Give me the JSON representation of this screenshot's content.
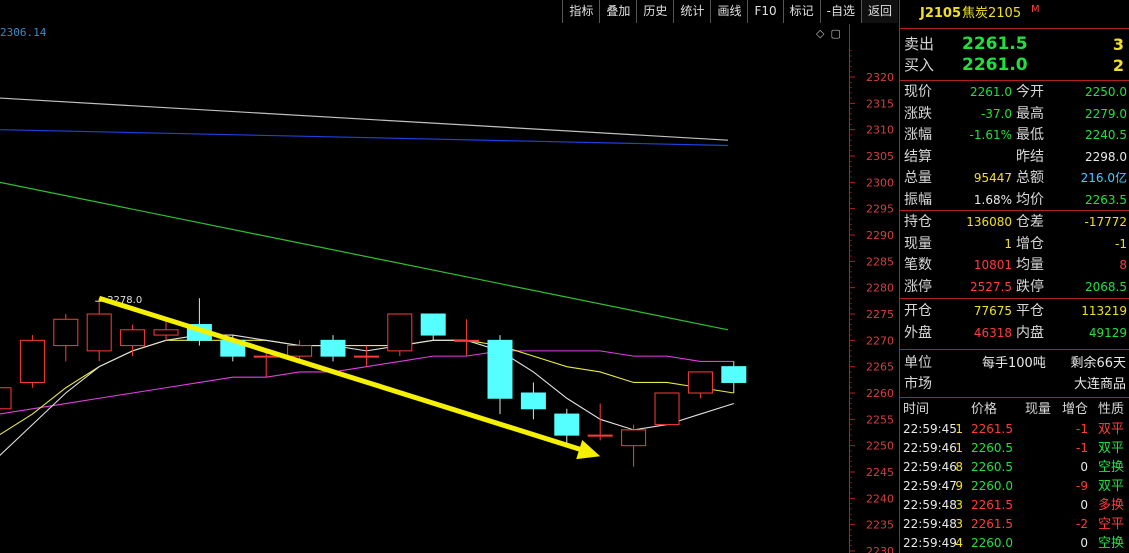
{
  "toolbar": {
    "buttons": [
      "指标",
      "叠加",
      "历史",
      "统计",
      "画线",
      "F10",
      "标记",
      "-自选",
      "返回"
    ]
  },
  "chart": {
    "top_left_value": "2306.14",
    "high_annotation": "2278.0",
    "colors": {
      "bull": "#ff3b3b",
      "bear": "#55ffff",
      "ma_white": "#e0e0e0",
      "ma_yellow": "#e8e840",
      "ma_magenta": "#e040e0",
      "ma_green": "#30c030",
      "ma_blue": "#2040e0",
      "ma_gray": "#c0c0c0",
      "arrow": "#f5f000",
      "axis_red": "#b02020"
    }
  },
  "chart_data": {
    "type": "candlestick",
    "ylim": [
      2230,
      2325
    ],
    "y_ticks": [
      2320,
      2315,
      2310,
      2305,
      2300,
      2295,
      2290,
      2285,
      2280,
      2275,
      2270,
      2265,
      2260,
      2255,
      2250,
      2245,
      2240,
      2235,
      2230
    ],
    "candles": [
      {
        "o": 2257,
        "c": 2261,
        "h": 2262,
        "l": 2256
      },
      {
        "o": 2262,
        "c": 2270,
        "h": 2271,
        "l": 2261
      },
      {
        "o": 2269,
        "c": 2274,
        "h": 2275,
        "l": 2266
      },
      {
        "o": 2268,
        "c": 2275,
        "h": 2278,
        "l": 2266
      },
      {
        "o": 2269,
        "c": 2272,
        "h": 2273,
        "l": 2267
      },
      {
        "o": 2271,
        "c": 2272,
        "h": 2274,
        "l": 2270
      },
      {
        "o": 2273,
        "c": 2270,
        "h": 2278,
        "l": 2269
      },
      {
        "o": 2270,
        "c": 2267,
        "h": 2271,
        "l": 2266
      },
      {
        "o": 2267,
        "c": 2267,
        "h": 2268,
        "l": 2263
      },
      {
        "o": 2267,
        "c": 2269,
        "h": 2270,
        "l": 2266
      },
      {
        "o": 2270,
        "c": 2267,
        "h": 2271,
        "l": 2266
      },
      {
        "o": 2267,
        "c": 2267,
        "h": 2269,
        "l": 2265
      },
      {
        "o": 2268,
        "c": 2275,
        "h": 2275,
        "l": 2267
      },
      {
        "o": 2275,
        "c": 2271,
        "h": 2275,
        "l": 2270
      },
      {
        "o": 2270,
        "c": 2270,
        "h": 2274,
        "l": 2267
      },
      {
        "o": 2270,
        "c": 2259,
        "h": 2271,
        "l": 2256
      },
      {
        "o": 2260,
        "c": 2257,
        "h": 2262,
        "l": 2255
      },
      {
        "o": 2256,
        "c": 2252,
        "h": 2257,
        "l": 2250
      },
      {
        "o": 2252,
        "c": 2252,
        "h": 2258,
        "l": 2251
      },
      {
        "o": 2250,
        "c": 2253,
        "h": 2254,
        "l": 2246
      },
      {
        "o": 2254,
        "c": 2260,
        "h": 2260,
        "l": 2254
      },
      {
        "o": 2260,
        "c": 2264,
        "h": 2264,
        "l": 2259
      },
      {
        "o": 2265,
        "c": 2262,
        "h": 2266,
        "l": 2260
      }
    ],
    "ma_white": [
      2248,
      2254,
      2260,
      2265,
      2268,
      2270,
      2271,
      2271,
      2270,
      2269,
      2269,
      2268,
      2269,
      2270,
      2270,
      2268,
      2264,
      2259,
      2255,
      2253,
      2254,
      2256,
      2258
    ],
    "ma_yellow": [
      2252,
      2256,
      2261,
      2265,
      2268,
      2270,
      2270,
      2270,
      2270,
      2269,
      2269,
      2269,
      2269,
      2270,
      2270,
      2269,
      2267,
      2265,
      2264,
      2262,
      2262,
      2261,
      2260
    ],
    "ma_magenta": [
      2256,
      2257,
      2258,
      2259,
      2260,
      2261,
      2262,
      2263,
      2263,
      2264,
      2264,
      2265,
      2266,
      2267,
      2267,
      2268,
      2268,
      2268,
      2268,
      2267,
      2267,
      2266,
      2266
    ],
    "ma_green_start": 2300,
    "ma_green_end": 2272,
    "ma_blue_start": 2310,
    "ma_blue_end": 2307,
    "ma_gray_start": 2316,
    "ma_gray_end": 2308,
    "arrow_from": {
      "index": 3,
      "value": 2278
    },
    "arrow_to": {
      "index": 18,
      "value": 2248
    }
  },
  "quote": {
    "code": "J2105",
    "name": "焦炭2105",
    "badge": "M",
    "ask": {
      "label": "卖出",
      "price": "2261.5",
      "vol": "3"
    },
    "bid": {
      "label": "买入",
      "price": "2261.0",
      "vol": "2"
    },
    "rows1": [
      {
        "l1": "现价",
        "v1": "2261.0",
        "c1": "green",
        "l2": "今开",
        "v2": "2250.0",
        "c2": "green"
      },
      {
        "l1": "涨跌",
        "v1": "-37.0",
        "c1": "green",
        "l2": "最高",
        "v2": "2279.0",
        "c2": "green"
      },
      {
        "l1": "涨幅",
        "v1": "-1.61%",
        "c1": "green",
        "l2": "最低",
        "v2": "2240.5",
        "c2": "green"
      },
      {
        "l1": "结算",
        "v1": "",
        "c1": "white",
        "l2": "昨结",
        "v2": "2298.0",
        "c2": "white"
      },
      {
        "l1": "总量",
        "v1": "95447",
        "c1": "yellow",
        "l2": "总额",
        "v2": "216.0亿",
        "c2": "cyan"
      },
      {
        "l1": "振幅",
        "v1": "1.68%",
        "c1": "white",
        "l2": "均价",
        "v2": "2263.5",
        "c2": "green"
      }
    ],
    "rows2": [
      {
        "l1": "持仓",
        "v1": "136080",
        "c1": "yellow",
        "l2": "仓差",
        "v2": "-17772",
        "c2": "yellow"
      },
      {
        "l1": "现量",
        "v1": "1",
        "c1": "yellow",
        "l2": "增仓",
        "v2": "-1",
        "c2": "yellow"
      },
      {
        "l1": "笔数",
        "v1": "10801",
        "c1": "red",
        "l2": "均量",
        "v2": "8",
        "c2": "red"
      },
      {
        "l1": "涨停",
        "v1": "2527.5",
        "c1": "red",
        "l2": "跌停",
        "v2": "2068.5",
        "c2": "green"
      }
    ],
    "rows3": [
      {
        "l1": "开仓",
        "v1": "77675",
        "c1": "yellow",
        "l2": "平仓",
        "v2": "113219",
        "c2": "yellow"
      },
      {
        "l1": "外盘",
        "v1": "46318",
        "c1": "red",
        "l2": "内盘",
        "v2": "49129",
        "c2": "green"
      }
    ],
    "unit": {
      "label": "单位",
      "value": "每手100吨",
      "extra": "剩余66天"
    },
    "market": {
      "label": "市场",
      "value": "大连商品"
    },
    "ticks_header": [
      "时间",
      "价格",
      "现量",
      "增仓",
      "性质"
    ],
    "ticks": [
      {
        "time": "22:59:45",
        "price": "2261.5",
        "vol": "1",
        "oi": "-1",
        "nature": "双平",
        "pc": "red",
        "nc": "red"
      },
      {
        "time": "22:59:46",
        "price": "2260.5",
        "vol": "1",
        "oi": "-1",
        "nature": "双平",
        "pc": "green",
        "nc": "green"
      },
      {
        "time": "22:59:46",
        "price": "2260.5",
        "vol": "8",
        "oi": "0",
        "nature": "空换",
        "pc": "green",
        "nc": "green"
      },
      {
        "time": "22:59:47",
        "price": "2260.0",
        "vol": "9",
        "oi": "-9",
        "nature": "双平",
        "pc": "green",
        "nc": "green"
      },
      {
        "time": "22:59:48",
        "price": "2261.5",
        "vol": "3",
        "oi": "0",
        "nature": "多换",
        "pc": "red",
        "nc": "red"
      },
      {
        "time": "22:59:48",
        "price": "2261.5",
        "vol": "3",
        "oi": "-2",
        "nature": "空平",
        "pc": "red",
        "nc": "red"
      },
      {
        "time": "22:59:49",
        "price": "2260.0",
        "vol": "4",
        "oi": "0",
        "nature": "空换",
        "pc": "green",
        "nc": "green"
      }
    ]
  }
}
